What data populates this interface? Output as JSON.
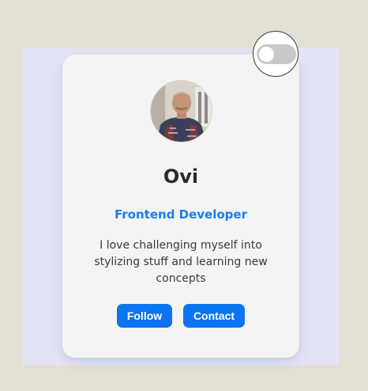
{
  "profile": {
    "name": "Ovi",
    "role": "Frontend Developer",
    "bio": "I love challenging myself into stylizing stuff and learning new concepts",
    "avatar_icon": "profile-photo"
  },
  "actions": {
    "follow_label": "Follow",
    "contact_label": "Contact"
  },
  "theme_toggle": {
    "state": "off"
  },
  "colors": {
    "background": "#e2e0d4",
    "panel": "#e2e4f5",
    "card": "#f4f4f4",
    "accent": "#0d74ef",
    "role_text": "#1a7ee8",
    "toggle_track": "#c8c8c8"
  }
}
